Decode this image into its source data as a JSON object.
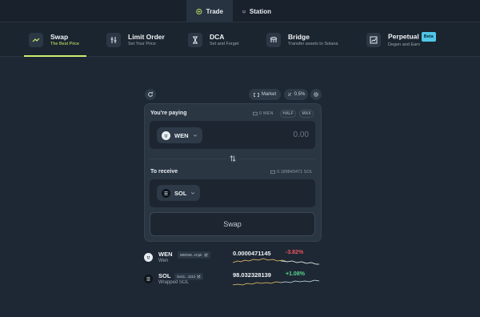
{
  "topbar": {
    "tabs": [
      {
        "label": "Trade",
        "icon": "trade-icon",
        "active": true
      },
      {
        "label": "Station",
        "icon": "station-icon",
        "active": false
      }
    ]
  },
  "nav": {
    "items": [
      {
        "title": "Swap",
        "subtitle": "The Best Price",
        "icon": "swap-icon",
        "active": true
      },
      {
        "title": "Limit Order",
        "subtitle": "Set Your Price",
        "icon": "limit-order-icon"
      },
      {
        "title": "DCA",
        "subtitle": "Set and Forget",
        "icon": "hourglass-icon"
      },
      {
        "title": "Bridge",
        "subtitle": "Transfer assets to Solana",
        "icon": "bridge-icon"
      },
      {
        "title": "Perpetual",
        "subtitle": "Degen and Earn",
        "badge": "Beta",
        "icon": "perpetual-icon"
      }
    ]
  },
  "controls": {
    "market_label": "Market",
    "slippage_label": "0.5%"
  },
  "swap": {
    "paying_label": "You're paying",
    "paying_balance": "0 WEN",
    "half_label": "HALF",
    "max_label": "MAX",
    "from_token": "WEN",
    "amount_value": "0.00",
    "receive_label": "To receive",
    "receive_balance": "0.189843471 SOL",
    "to_token": "SOL",
    "swap_button": "Swap"
  },
  "tokens": [
    {
      "symbol": "WEN",
      "name": "Wen",
      "address": "WENW...tCpk",
      "price": "0.0000471145",
      "change": "-3.82%",
      "change_color": "#f0535d"
    },
    {
      "symbol": "SOL",
      "name": "Wrapped SOL",
      "address": "So11...1112",
      "price": "98.032328139",
      "change": "+1.08%",
      "change_color": "#58d68d"
    }
  ],
  "colors": {
    "accent": "#c8ef6e",
    "background": "#1e2834",
    "card": "#2b3643",
    "badge": "#4fc7e8"
  }
}
